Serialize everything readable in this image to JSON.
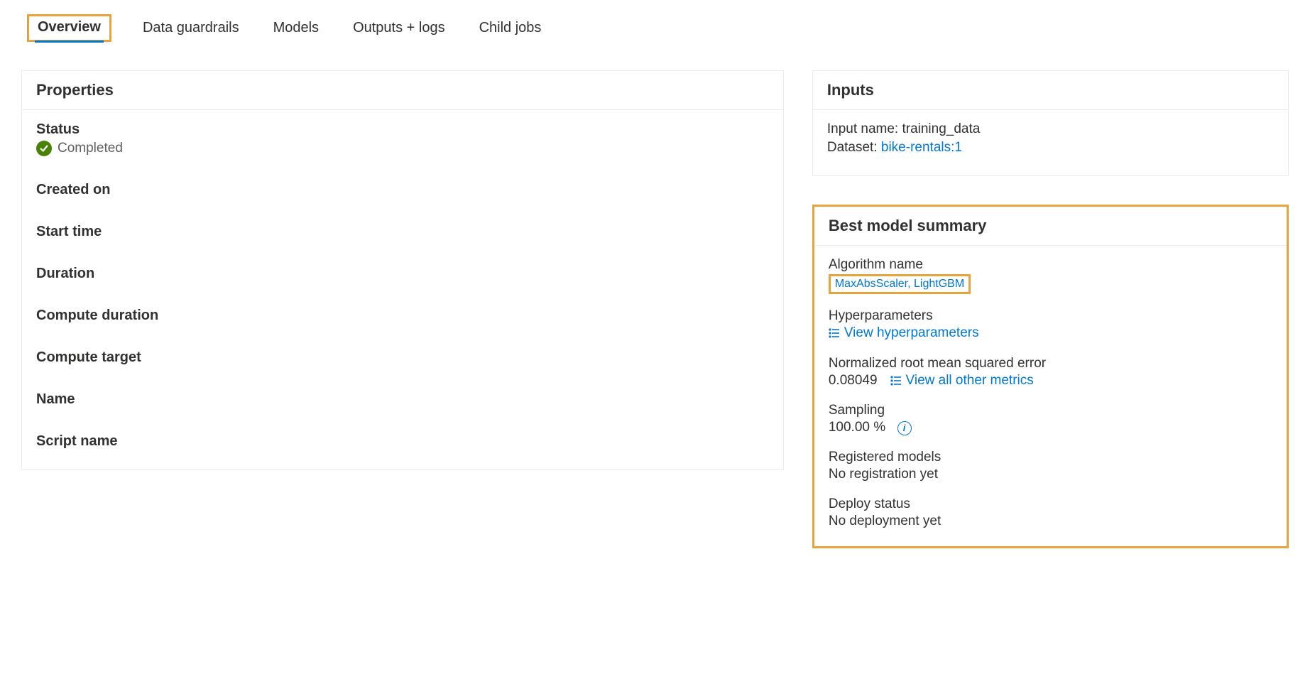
{
  "tabs": {
    "overview": "Overview",
    "dataGuardrails": "Data guardrails",
    "models": "Models",
    "outputsLogs": "Outputs + logs",
    "childJobs": "Child jobs"
  },
  "properties": {
    "heading": "Properties",
    "status": {
      "label": "Status",
      "value": "Completed"
    },
    "createdOn": {
      "label": "Created on",
      "value": ""
    },
    "startTime": {
      "label": "Start time",
      "value": ""
    },
    "duration": {
      "label": "Duration",
      "value": ""
    },
    "computeDuration": {
      "label": "Compute duration",
      "value": ""
    },
    "computeTarget": {
      "label": "Compute target",
      "value": ""
    },
    "name": {
      "label": "Name",
      "value": ""
    },
    "scriptName": {
      "label": "Script name",
      "value": ""
    }
  },
  "inputs": {
    "heading": "Inputs",
    "inputNameLabel": "Input name:",
    "inputNameValue": "training_data",
    "datasetLabel": "Dataset:",
    "datasetLink": "bike-rentals:1"
  },
  "bestModel": {
    "heading": "Best model summary",
    "algorithm": {
      "label": "Algorithm name",
      "value": "MaxAbsScaler, LightGBM"
    },
    "hyperparameters": {
      "label": "Hyperparameters",
      "link": "View hyperparameters"
    },
    "nrmse": {
      "label": "Normalized root mean squared error",
      "value": "0.08049",
      "link": "View all other metrics"
    },
    "sampling": {
      "label": "Sampling",
      "value": "100.00 %"
    },
    "registered": {
      "label": "Registered models",
      "value": "No registration yet"
    },
    "deploy": {
      "label": "Deploy status",
      "value": "No deployment yet"
    }
  }
}
